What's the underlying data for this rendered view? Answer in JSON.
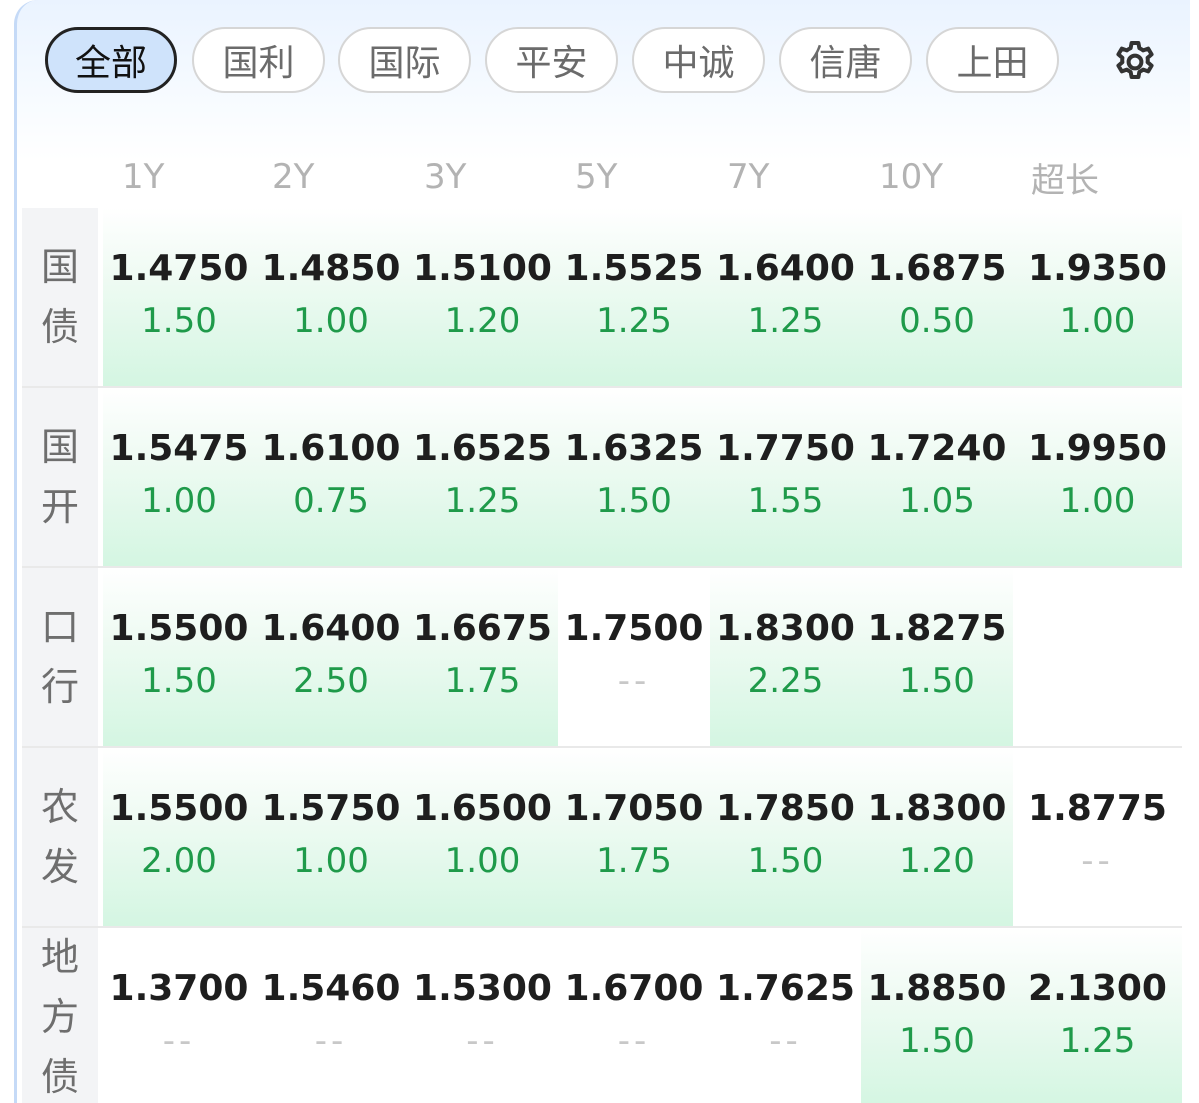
{
  "tabs": [
    "全部",
    "国利",
    "国际",
    "平安",
    "中诚",
    "信唐",
    "上田"
  ],
  "active_tab": "全部",
  "settings_icon": "gear-icon",
  "columns": [
    "1Y",
    "2Y",
    "3Y",
    "5Y",
    "7Y",
    "10Y",
    "超长"
  ],
  "colors": {
    "up": "#1f9a4a",
    "active_tab_bg": "#cfe3fb",
    "green_cell": "#d4f6e2"
  },
  "rows": [
    {
      "label": [
        "国",
        "债"
      ],
      "cells": [
        {
          "yield": "1.4750",
          "chg": "1.50",
          "green": true
        },
        {
          "yield": "1.4850",
          "chg": "1.00",
          "green": true
        },
        {
          "yield": "1.5100",
          "chg": "1.20",
          "green": true
        },
        {
          "yield": "1.5525",
          "chg": "1.25",
          "green": true
        },
        {
          "yield": "1.6400",
          "chg": "1.25",
          "green": true
        },
        {
          "yield": "1.6875",
          "chg": "0.50",
          "green": true
        },
        {
          "yield": "1.9350",
          "chg": "1.00",
          "green": true
        }
      ]
    },
    {
      "label": [
        "国",
        "开"
      ],
      "cells": [
        {
          "yield": "1.5475",
          "chg": "1.00",
          "green": true
        },
        {
          "yield": "1.6100",
          "chg": "0.75",
          "green": true
        },
        {
          "yield": "1.6525",
          "chg": "1.25",
          "green": true
        },
        {
          "yield": "1.6325",
          "chg": "1.50",
          "green": true
        },
        {
          "yield": "1.7750",
          "chg": "1.55",
          "green": true
        },
        {
          "yield": "1.7240",
          "chg": "1.05",
          "green": true
        },
        {
          "yield": "1.9950",
          "chg": "1.00",
          "green": true
        }
      ]
    },
    {
      "label": [
        "口",
        "行"
      ],
      "cells": [
        {
          "yield": "1.5500",
          "chg": "1.50",
          "green": true
        },
        {
          "yield": "1.6400",
          "chg": "2.50",
          "green": true
        },
        {
          "yield": "1.6675",
          "chg": "1.75",
          "green": true
        },
        {
          "yield": "1.7500",
          "chg": "--",
          "green": false
        },
        {
          "yield": "1.8300",
          "chg": "2.25",
          "green": true
        },
        {
          "yield": "1.8275",
          "chg": "1.50",
          "green": true
        },
        {
          "yield": "",
          "chg": "",
          "green": false
        }
      ]
    },
    {
      "label": [
        "农",
        "发"
      ],
      "cells": [
        {
          "yield": "1.5500",
          "chg": "2.00",
          "green": true
        },
        {
          "yield": "1.5750",
          "chg": "1.00",
          "green": true
        },
        {
          "yield": "1.6500",
          "chg": "1.00",
          "green": true
        },
        {
          "yield": "1.7050",
          "chg": "1.75",
          "green": true
        },
        {
          "yield": "1.7850",
          "chg": "1.50",
          "green": true
        },
        {
          "yield": "1.8300",
          "chg": "1.20",
          "green": true
        },
        {
          "yield": "1.8775",
          "chg": "--",
          "green": false
        }
      ]
    },
    {
      "label": [
        "地",
        "方",
        "债"
      ],
      "cells": [
        {
          "yield": "1.3700",
          "chg": "--",
          "green": false
        },
        {
          "yield": "1.5460",
          "chg": "--",
          "green": false
        },
        {
          "yield": "1.5300",
          "chg": "--",
          "green": false
        },
        {
          "yield": "1.6700",
          "chg": "--",
          "green": false
        },
        {
          "yield": "1.7625",
          "chg": "--",
          "green": false
        },
        {
          "yield": "1.8850",
          "chg": "1.50",
          "green": true
        },
        {
          "yield": "2.1300",
          "chg": "1.25",
          "green": true
        }
      ]
    }
  ]
}
